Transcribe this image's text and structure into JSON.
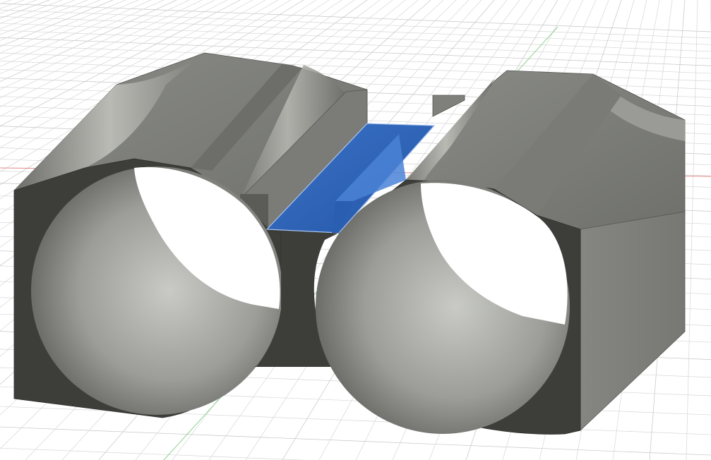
{
  "viewport": {
    "background": "#ffffff",
    "grid_color": "#d6d6d6",
    "grid_major_color": "#c4c4c4",
    "x_axis_color": "#e08a8a",
    "y_axis_color": "#8fd08f"
  },
  "model": {
    "body_color": "#7c7d78",
    "side_face_color": "#3d3e3a",
    "edge_color": "#4a4b47",
    "selection_color": "#2f63b8",
    "selection_highlight": "#3b74c9",
    "selected_face": "center-channel-bottom-face"
  }
}
